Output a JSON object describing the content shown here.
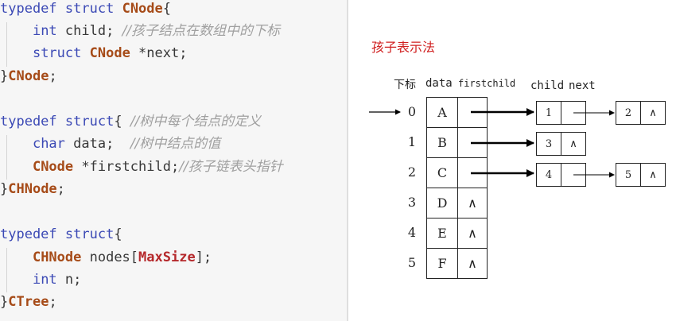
{
  "code": {
    "typedef": "typedef",
    "struct": "struct",
    "int": "int",
    "char": "char",
    "cnode": "CNode",
    "chnode": "CHNode",
    "ctree": "CTree",
    "maxsize": "MaxSize",
    "child_name": " child;",
    "next_name": " *next;",
    "data_name": " data;",
    "firstchild_name": " *firstchild;",
    "nodes_name": " nodes[",
    "nodes_close": "];",
    "n_name": " n;",
    "comment_child": "//孩子结点在数组中的下标",
    "comment_struct": "//树中每个结点的定义",
    "comment_data": "//树中结点的值",
    "comment_firstchild": "//孩子链表头指针"
  },
  "diagram": {
    "title": "孩子表示法",
    "header_index": "下标",
    "header_data": "data",
    "header_firstchild": "firstchild",
    "header_child": "child",
    "header_next": "next",
    "null_symbol": "∧",
    "rows": [
      {
        "index": "0",
        "data": "A"
      },
      {
        "index": "1",
        "data": "B"
      },
      {
        "index": "2",
        "data": "C"
      },
      {
        "index": "3",
        "data": "D"
      },
      {
        "index": "4",
        "data": "E"
      },
      {
        "index": "5",
        "data": "F"
      }
    ],
    "child_nodes": [
      "1",
      "2",
      "3",
      "4",
      "5"
    ]
  }
}
